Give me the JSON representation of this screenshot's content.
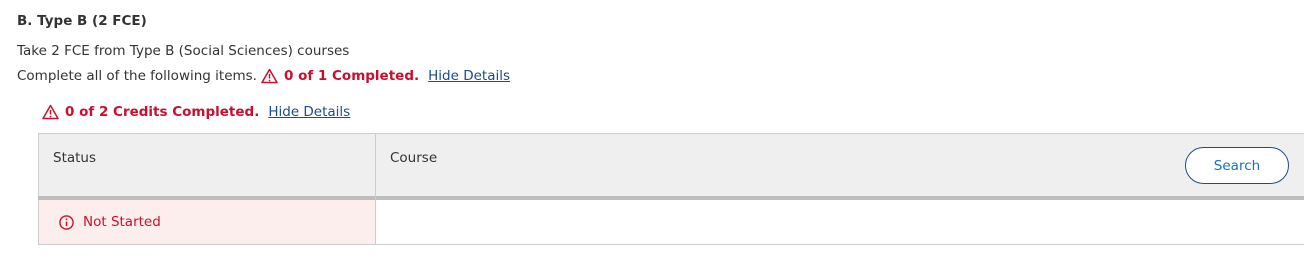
{
  "requirement": {
    "title": "B. Type B (2 FCE)",
    "description": "Take 2 FCE from Type B (Social Sciences) courses",
    "instruction": "Complete all of the following items.",
    "completion_status": "0 of 1 Completed.",
    "hide_details_label": "Hide Details"
  },
  "sub_requirement": {
    "credits_status": "0 of 2 Credits Completed.",
    "hide_details_label": "Hide Details"
  },
  "table": {
    "headers": {
      "status": "Status",
      "course": "Course"
    },
    "search_label": "Search",
    "rows": [
      {
        "status": "Not Started",
        "course": ""
      }
    ]
  },
  "colors": {
    "error_red": "#c8102e",
    "link_blue": "#1a4d8c",
    "error_bg": "#fdeeee"
  },
  "icons": {
    "warning": "warning-triangle-icon",
    "info": "info-circle-icon"
  }
}
